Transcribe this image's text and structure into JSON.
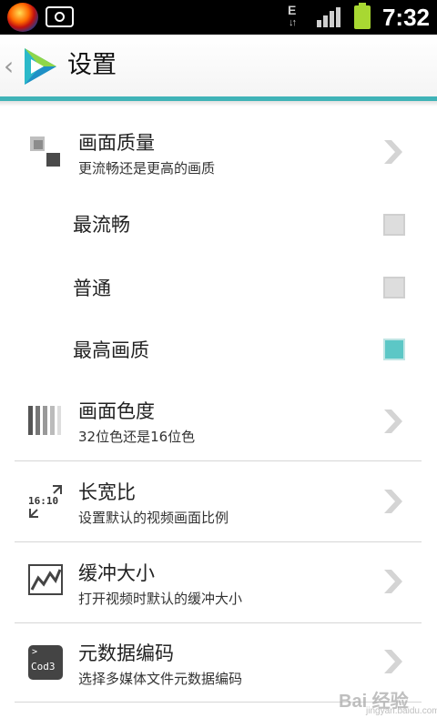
{
  "status_bar": {
    "app_icon": "app-logo-orb-icon",
    "notification_icon": "camera-icon",
    "network_type": "E",
    "signal_icon": "signal-bars-icon",
    "battery_icon": "battery-icon",
    "battery_color": "#a8d832",
    "time": "7:32"
  },
  "header": {
    "back_icon": "back-chevron-icon",
    "logo_icon": "player-logo-icon",
    "title": "设置",
    "accent_color": "#3fb3b7"
  },
  "settings": {
    "quality": {
      "title": "画面质量",
      "subtitle": "更流畅还是更高的画质",
      "icon": "quality-squares-icon",
      "options": [
        {
          "label": "最流畅",
          "checked": false
        },
        {
          "label": "普通",
          "checked": false
        },
        {
          "label": "最高画质",
          "checked": true
        }
      ]
    },
    "color_depth": {
      "title": "画面色度",
      "subtitle": "32位色还是16位色",
      "icon": "color-bars-icon"
    },
    "aspect_ratio": {
      "title": "长宽比",
      "subtitle": "设置默认的视频画面比例",
      "icon": "aspect-ratio-icon",
      "icon_text": "16:10"
    },
    "buffer_size": {
      "title": "缓冲大小",
      "subtitle": "打开视频时默认的缓冲大小",
      "icon": "buffer-graph-icon"
    },
    "metadata_encoding": {
      "title": "元数据编码",
      "subtitle": "选择多媒体文件元数据编码",
      "icon": "codec-icon",
      "icon_text": "Cod3"
    }
  },
  "checkbox_checked_color": "#5cc7c6",
  "watermark": {
    "text": "Bai 经验",
    "sub": "jingyan.baidu.com"
  }
}
